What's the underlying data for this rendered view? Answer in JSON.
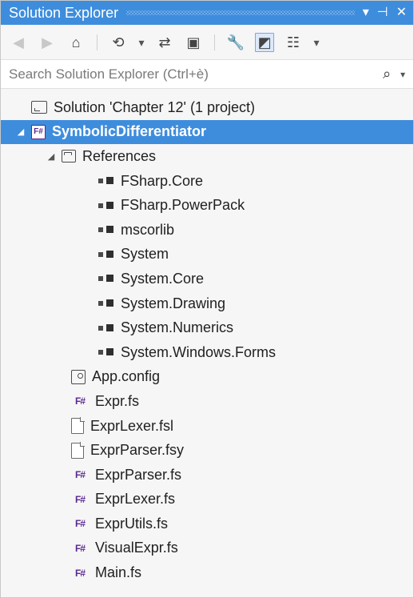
{
  "window": {
    "title": "Solution Explorer",
    "actions": [
      "▾",
      "⊣",
      "✕"
    ]
  },
  "toolbar": {
    "buttons": [
      {
        "name": "back-button",
        "glyph": "◀",
        "disabled": true
      },
      {
        "name": "forward-button",
        "glyph": "▶",
        "disabled": true
      },
      {
        "name": "home-button",
        "glyph": "⌂"
      },
      {
        "name": "pending-changes-filter-button",
        "glyph": "⟲"
      },
      {
        "name": "pending-changes-dropdown-button",
        "glyph": "▾"
      },
      {
        "name": "sync-with-active-document-button",
        "glyph": "⇄"
      },
      {
        "name": "collapse-all-button",
        "glyph": "▣"
      },
      {
        "name": "properties-button",
        "glyph": "🔧"
      },
      {
        "name": "preview-selected-items-button",
        "glyph": "◩",
        "active": true
      },
      {
        "name": "view-class-diagram-button",
        "glyph": "☷"
      },
      {
        "name": "view-class-diagram-dropdown-button",
        "glyph": "▾"
      }
    ]
  },
  "search": {
    "placeholder": "Search Solution Explorer (Ctrl+è)",
    "icon": "search-icon",
    "dropdown_icon": "chevron-down-icon"
  },
  "tree": {
    "items": [
      {
        "label": "Solution 'Chapter 12' (1 project)",
        "level": 0,
        "icon": "solution-icon",
        "expander": ""
      },
      {
        "label": "SymbolicDifferentiator",
        "level": 0,
        "icon": "fsharp-project-icon",
        "expander": "◢",
        "selected": true
      },
      {
        "label": "References",
        "level": 1,
        "icon": "references-folder-icon",
        "expander": "◢"
      },
      {
        "label": "FSharp.Core",
        "level": 2,
        "icon": "reference-icon",
        "expander": ""
      },
      {
        "label": "FSharp.PowerPack",
        "level": 2,
        "icon": "reference-icon",
        "expander": ""
      },
      {
        "label": "mscorlib",
        "level": 2,
        "icon": "reference-icon",
        "expander": ""
      },
      {
        "label": "System",
        "level": 2,
        "icon": "reference-icon",
        "expander": ""
      },
      {
        "label": "System.Core",
        "level": 2,
        "icon": "reference-icon",
        "expander": ""
      },
      {
        "label": "System.Drawing",
        "level": 2,
        "icon": "reference-icon",
        "expander": ""
      },
      {
        "label": "System.Numerics",
        "level": 2,
        "icon": "reference-icon",
        "expander": ""
      },
      {
        "label": "System.Windows.Forms",
        "level": 2,
        "icon": "reference-icon",
        "expander": ""
      },
      {
        "label": "App.config",
        "level": 1,
        "icon": "config-file-icon",
        "expander": ""
      },
      {
        "label": "Expr.fs",
        "level": 1,
        "icon": "fsharp-file-icon",
        "expander": ""
      },
      {
        "label": "ExprLexer.fsl",
        "level": 1,
        "icon": "text-file-icon",
        "expander": ""
      },
      {
        "label": "ExprParser.fsy",
        "level": 1,
        "icon": "text-file-icon",
        "expander": ""
      },
      {
        "label": "ExprParser.fs",
        "level": 1,
        "icon": "fsharp-file-icon",
        "expander": ""
      },
      {
        "label": "ExprLexer.fs",
        "level": 1,
        "icon": "fsharp-file-icon",
        "expander": ""
      },
      {
        "label": "ExprUtils.fs",
        "level": 1,
        "icon": "fsharp-file-icon",
        "expander": ""
      },
      {
        "label": "VisualExpr.fs",
        "level": 1,
        "icon": "fsharp-file-icon",
        "expander": ""
      },
      {
        "label": "Main.fs",
        "level": 1,
        "icon": "fsharp-file-icon",
        "expander": ""
      }
    ]
  },
  "colors": {
    "selection": "#3e8ddd",
    "fsharp": "#5a2a8f"
  }
}
